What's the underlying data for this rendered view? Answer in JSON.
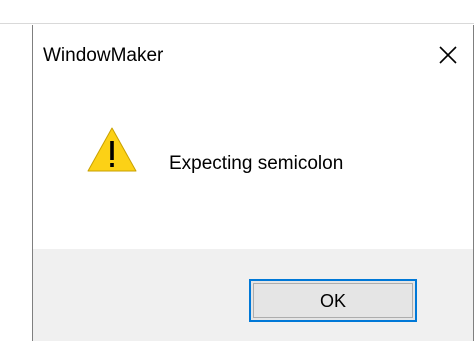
{
  "window": {
    "title": "WindowMaker",
    "close_icon": "close-icon"
  },
  "dialog": {
    "icon": "warning-icon",
    "message": "Expecting semicolon",
    "ok_label": "OK"
  },
  "colors": {
    "accent": "#0078d7",
    "warning_fill": "#fcd116",
    "footer_bg": "#f0f0f0",
    "button_bg": "#e5e5e5"
  }
}
